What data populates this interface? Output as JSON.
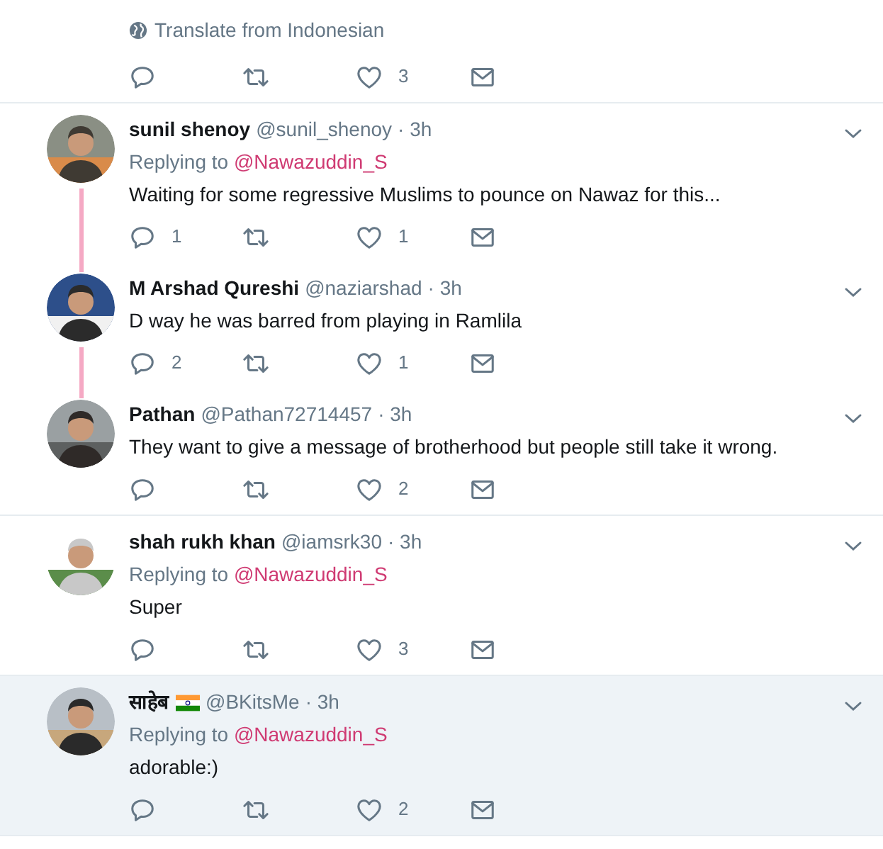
{
  "previous_tweet": {
    "translate_link": "Translate from Indonesian",
    "likes": "3"
  },
  "conversations": [
    {
      "highlighted": false,
      "tweets": [
        {
          "name": "sunil shenoy",
          "flag": false,
          "handle": "@sunil_shenoy",
          "time": "· 3h",
          "replying_label": "Replying to",
          "replying_to": "@Nawazuddin_S",
          "text": "Waiting for some regressive Muslims to pounce on Nawaz for this...",
          "replies": "1",
          "likes": "1"
        },
        {
          "name": "M Arshad Qureshi",
          "flag": false,
          "handle": "@naziarshad",
          "time": "· 3h",
          "text": "D way he was barred from playing in Ramlila",
          "replies": "2",
          "likes": "1"
        },
        {
          "name": "Pathan",
          "flag": false,
          "handle": "@Pathan72714457",
          "time": "· 3h",
          "text": "They want to give a message of brotherhood but people still take it wrong.",
          "likes": "2"
        }
      ]
    },
    {
      "highlighted": false,
      "tweets": [
        {
          "name": "shah rukh khan",
          "flag": false,
          "handle": "@iamsrk30",
          "time": "· 3h",
          "replying_label": "Replying to",
          "replying_to": "@Nawazuddin_S",
          "text": "Super",
          "likes": "3"
        }
      ]
    },
    {
      "highlighted": true,
      "tweets": [
        {
          "name": "साहेब",
          "flag": true,
          "handle": "@BKitsMe",
          "time": "· 3h",
          "replying_label": "Replying to",
          "replying_to": "@Nawazuddin_S",
          "text": "adorable:)",
          "likes": "2"
        }
      ]
    }
  ]
}
